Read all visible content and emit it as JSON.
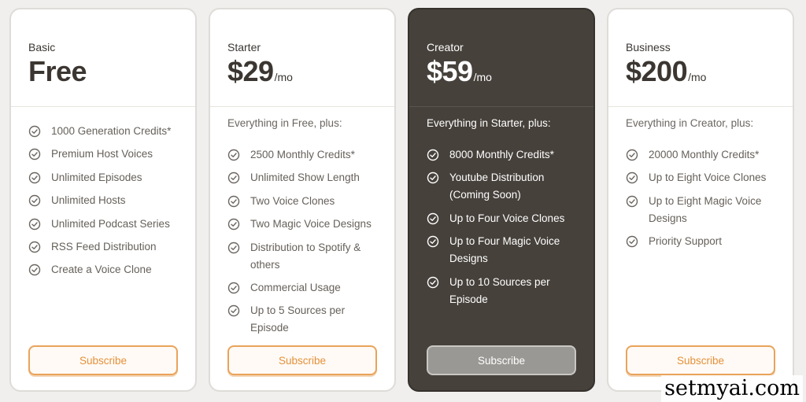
{
  "plans": [
    {
      "tier": "Basic",
      "price": "Free",
      "period": "",
      "intro": "",
      "features": [
        [
          "1000 Generation Credits*"
        ],
        [
          "Premium Host Voices"
        ],
        [
          "Unlimited Episodes"
        ],
        [
          "Unlimited Hosts"
        ],
        [
          "Unlimited Podcast Series"
        ],
        [
          "RSS Feed Distribution"
        ],
        [
          "Create a Voice Clone"
        ]
      ],
      "button": "Subscribe"
    },
    {
      "tier": "Starter",
      "price": "$29",
      "period": "/mo",
      "intro": "Everything in Free, plus:",
      "features": [
        [
          "2500 Monthly Credits*"
        ],
        [
          "Unlimited Show Length"
        ],
        [
          "Two Voice Clones"
        ],
        [
          "Two Magic Voice Designs"
        ],
        [
          "Distribution to Spotify &",
          "others"
        ],
        [
          "Commercial Usage"
        ],
        [
          "Up to 5 Sources per",
          "Episode"
        ]
      ],
      "button": "Subscribe"
    },
    {
      "tier": "Creator",
      "price": "$59",
      "period": "/mo",
      "intro": "Everything in Starter, plus:",
      "features": [
        [
          "8000 Monthly Credits*"
        ],
        [
          "Youtube Distribution",
          "(Coming Soon)"
        ],
        [
          "Up to Four Voice Clones"
        ],
        [
          "Up to Four Magic Voice",
          "Designs"
        ],
        [
          "Up to 10 Sources per",
          "Episode"
        ]
      ],
      "button": "Subscribe",
      "highlighted": true
    },
    {
      "tier": "Business",
      "price": "$200",
      "period": "/mo",
      "intro": "Everything in Creator, plus:",
      "features": [
        [
          "20000 Monthly Credits*"
        ],
        [
          "Up to Eight Voice Clones"
        ],
        [
          "Up to Eight Magic Voice",
          "Designs"
        ],
        [
          "Priority Support"
        ]
      ],
      "button": "Subscribe"
    }
  ],
  "watermark": "setmyai.com",
  "colors": {
    "accent": "#e9a35a",
    "highlight_card": "#46413b",
    "text": "#3f3b36"
  },
  "icons": {
    "feature_check": "check-circle-icon"
  }
}
